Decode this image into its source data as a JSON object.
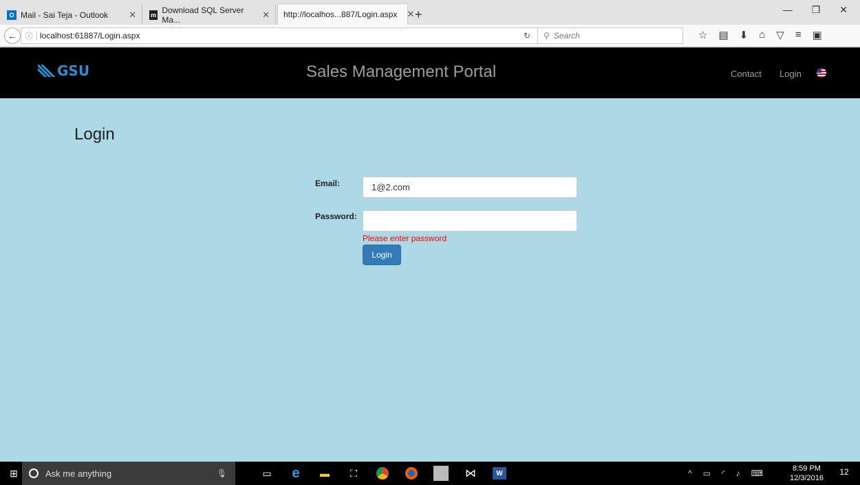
{
  "browser": {
    "tabs": [
      {
        "title": "Mail - Sai Teja - Outlook",
        "favicon": "O",
        "favicon_color": "#0072c6"
      },
      {
        "title": "Download SQL Server Ma...",
        "favicon": "m",
        "favicon_color": "#222222"
      },
      {
        "title": "http://localhos...887/Login.aspx",
        "favicon": "",
        "favicon_color": ""
      }
    ],
    "url": "localhost:61887/Login.aspx",
    "search_placeholder": "Search"
  },
  "header": {
    "logo_text": "GSU",
    "portal_title": "Sales Management Portal",
    "contact": "Contact",
    "login": "Login"
  },
  "form": {
    "heading": "Login",
    "email_label": "Email:",
    "email_value": "1@2.com",
    "password_label": "Password:",
    "password_value": "",
    "error": "Please enter password",
    "submit": "Login"
  },
  "taskbar": {
    "search_placeholder": "Ask me anything",
    "time": "8:59 PM",
    "date": "12/3/2016",
    "notifications": "12"
  },
  "colors": {
    "page_bg": "#add8e6",
    "header_bg": "#000000",
    "brand": "#2b8fd0",
    "button": "#337ab7",
    "error": "#ff0000"
  }
}
